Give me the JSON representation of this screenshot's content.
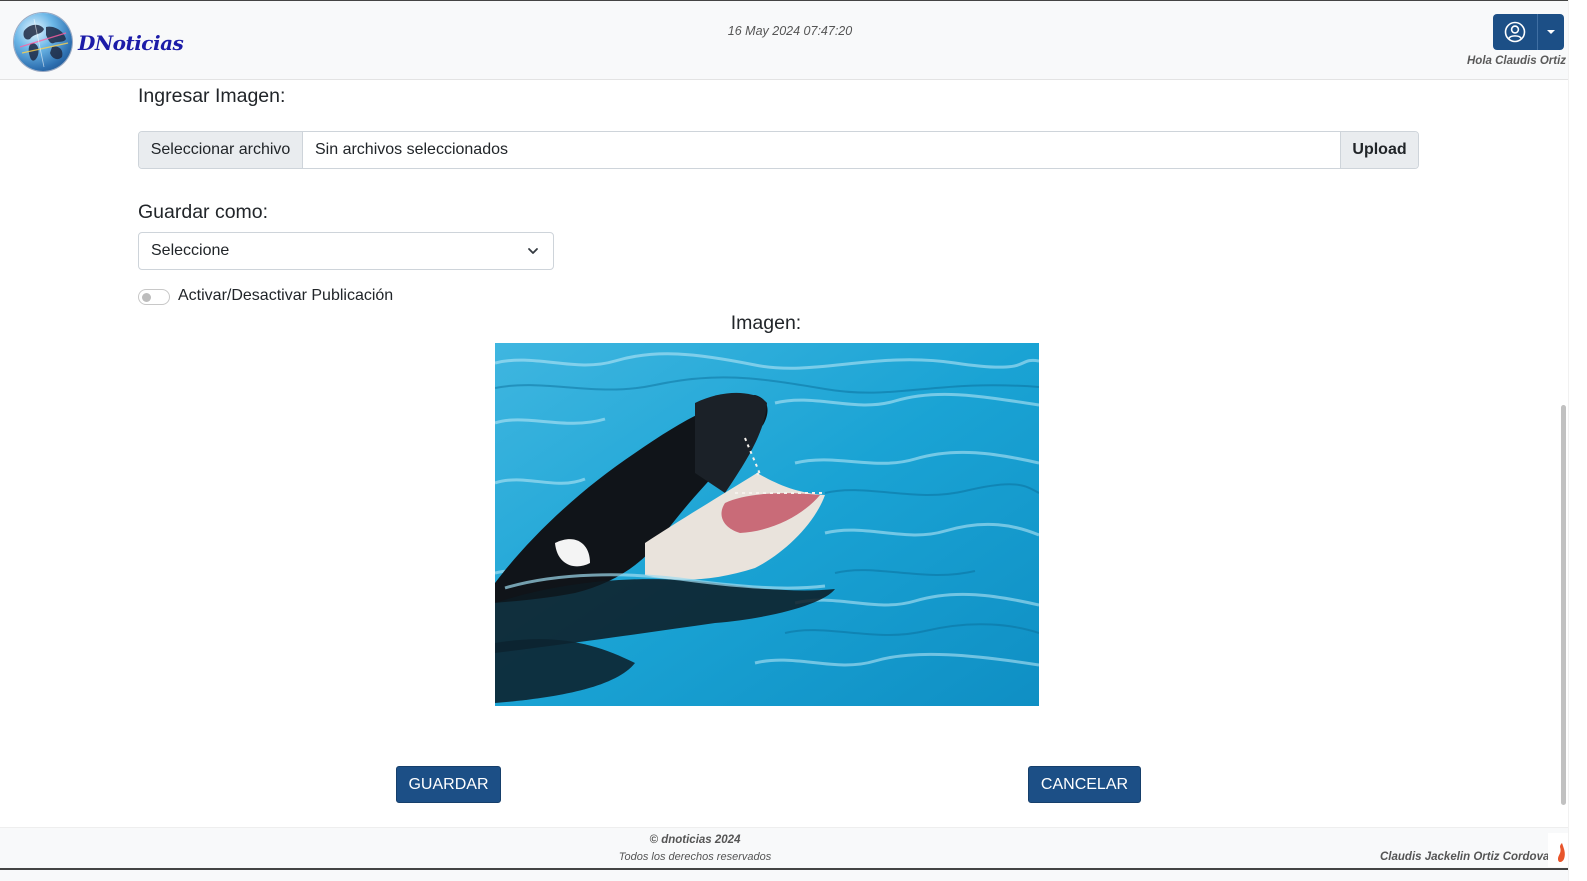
{
  "header": {
    "brand": "DNoticias",
    "datetime": "16 May 2024 07:47:20",
    "greeting": "Hola Claudis Ortiz"
  },
  "form": {
    "image_label": "Ingresar Imagen:",
    "file_select_label": "Seleccionar archivo",
    "file_name": "Sin archivos seleccionados",
    "upload_label": "Upload",
    "save_as_label": "Guardar como:",
    "save_as_selected": "Seleccione",
    "toggle_label": "Activar/Desactivar Publicación",
    "toggle_on": false,
    "preview_label": "Imagen:"
  },
  "actions": {
    "save_label": "GUARDAR",
    "cancel_label": "CANCELAR"
  },
  "footer": {
    "copyright": "© dnoticias 2024",
    "rights": "Todos los derechos reservados",
    "author": "Claudis Jackelin Ortiz Cordova"
  },
  "colors": {
    "primary": "#1c4f86",
    "topbar_bg": "#f8f9fa",
    "brand_text": "#1c1ca8"
  },
  "icons": {
    "user": "user-circle-icon",
    "caret": "caret-down-icon",
    "chevron": "chevron-down-icon"
  }
}
